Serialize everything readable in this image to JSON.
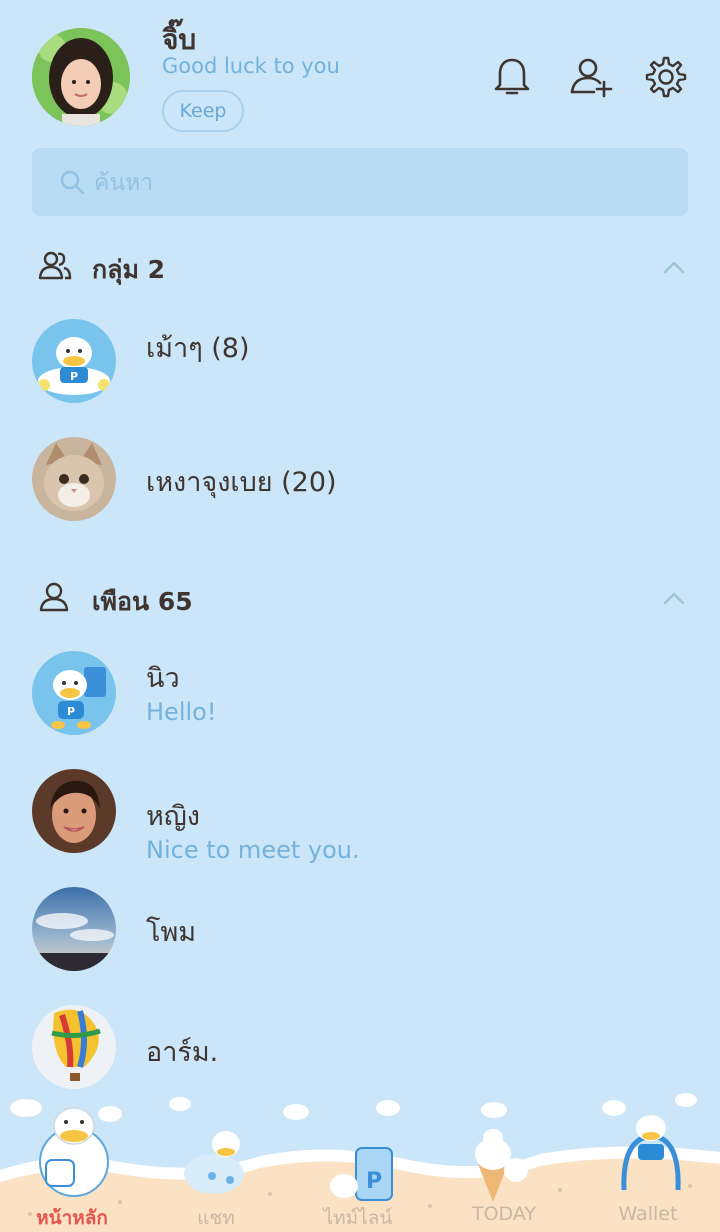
{
  "profile": {
    "name": "จิ๊บ",
    "status": "Good luck to you",
    "keep_label": "Keep"
  },
  "header_icons": [
    "bell-icon",
    "add-friend-icon",
    "settings-icon"
  ],
  "search": {
    "placeholder": "ค้นหา"
  },
  "groups_section": {
    "title": "กลุ่ม 2",
    "items": [
      {
        "name": "เม้าๆ (8)",
        "avatar": "duck-reading-avatar"
      },
      {
        "name": "เหงาจุงเบย (20)",
        "avatar": "cat-avatar"
      }
    ]
  },
  "friends_section": {
    "title": "เพือน 65",
    "items": [
      {
        "name": "นิว",
        "message": "Hello!",
        "avatar": "duck-avatar"
      },
      {
        "name": "หญิง",
        "message": "Nice to meet you.",
        "avatar": "woman-avatar"
      },
      {
        "name": "โพม",
        "message": "",
        "avatar": "sky-avatar"
      },
      {
        "name": "อาร์ม.",
        "message": "",
        "avatar": "balloon-avatar"
      }
    ]
  },
  "tabs": [
    {
      "label": "หน้าหลัก",
      "active": true
    },
    {
      "label": "แชท",
      "active": false
    },
    {
      "label": "ไทม์ไลน์",
      "active": false
    },
    {
      "label": "TODAY",
      "active": false
    },
    {
      "label": "Wallet",
      "active": false
    }
  ],
  "colors": {
    "background": "#cbe6f8",
    "accent": "#74b2db",
    "active_tab": "#e8554f"
  }
}
